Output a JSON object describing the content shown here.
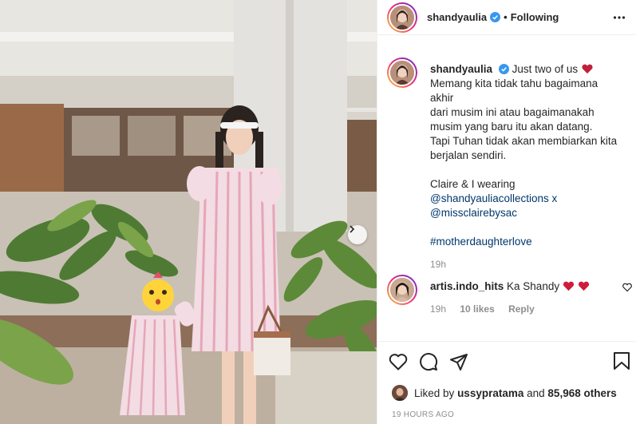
{
  "header": {
    "username": "shandyaulia",
    "separator": "•",
    "follow_status": "Following"
  },
  "caption": {
    "username": "shandyaulia",
    "first_line": "Just two of us",
    "lines": [
      "Memang kita tidak tahu bagaimana akhir",
      "dari musim ini atau bagaimanakah",
      "musim yang baru itu akan datang.",
      "Tapi Tuhan tidak akan membiarkan kita",
      "berjalan sendiri."
    ],
    "wearing": "Claire & I wearing",
    "mention1": "@shandyauliacollections x",
    "mention2": "@missclairebysac",
    "hashtag": "#motherdaughterlove",
    "time": "19h"
  },
  "comment": {
    "username": "artis.indo_hits",
    "text": "Ka Shandy",
    "time": "19h",
    "likes": "10 likes",
    "reply": "Reply"
  },
  "likes": {
    "prefix": "Liked by",
    "user": "ussypratama",
    "middle": "and",
    "others": "85,968 others"
  },
  "posted_ago": "19 HOURS AGO",
  "icons": [
    "more-icon",
    "heart-icon",
    "comment-icon",
    "share-icon",
    "bookmark-icon",
    "verified-badge-icon",
    "carousel-next-icon"
  ],
  "colors": {
    "verified": "#3897f0",
    "link": "#00376b",
    "heart": "#ed4956",
    "muted": "#8e8e8e"
  }
}
